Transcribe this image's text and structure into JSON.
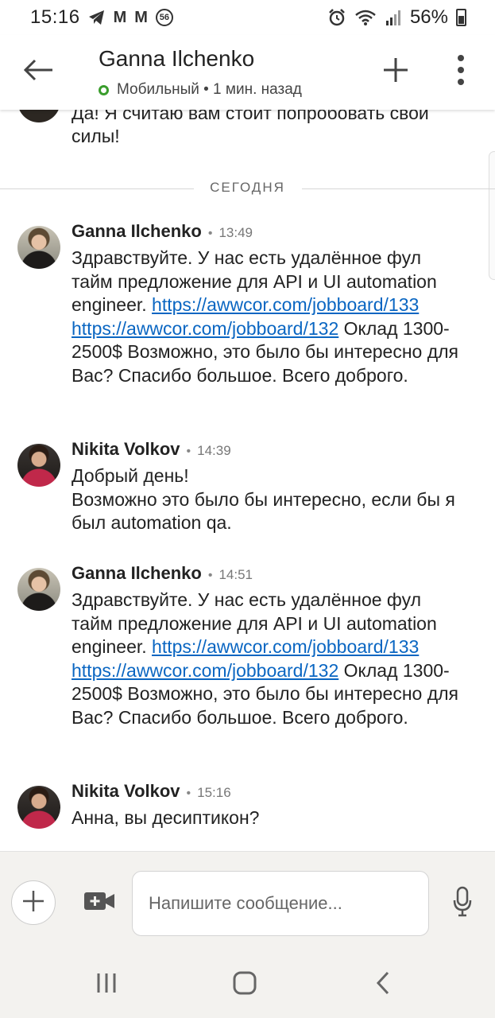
{
  "status_bar": {
    "time": "15:16",
    "notif_m1": "M",
    "notif_m2": "M",
    "notif_badge": "56",
    "battery": "56%"
  },
  "header": {
    "title": "Ganna Ilchenko",
    "presence": "Мобильный • 1 мин. назад",
    "presence_color": "#3a9d2c"
  },
  "previous_message": {
    "text": "Да! Я считаю вам стоит попробовать свои силы!"
  },
  "divider_label": "СЕГОДНЯ",
  "messages": [
    {
      "author": "Ganna Ilchenko",
      "separator": "•",
      "time": "13:49",
      "text_before": "Здравствуйте. У нас есть удалённое фул тайм предложение для API и UI automation engineer.",
      "link1": "https://awwcor.com/jobboard/133",
      "link2": "https://awwcor.com/jobboard/132",
      "text_after": "Оклад 1300-2500$ Возможно, это было бы интересно для Вас? Спасибо большое. Всего доброго."
    },
    {
      "author": "Nikita Volkov",
      "separator": "•",
      "time": "14:39",
      "line1": "Добрый день!",
      "line2": "Возможно это было бы интересно, если бы я был automation qa."
    },
    {
      "author": "Ganna Ilchenko",
      "separator": "•",
      "time": "14:51",
      "text_before": "Здравствуйте. У нас есть удалённое фул тайм предложение для API и UI automation engineer.",
      "link1": "https://awwcor.com/jobboard/133",
      "link2": "https://awwcor.com/jobboard/132",
      "text_after": "Оклад 1300-2500$ Возможно, это было бы интересно для Вас? Спасибо большое. Всего доброго."
    },
    {
      "author": "Nikita Volkov",
      "separator": "•",
      "time": "15:16",
      "line1": "Анна, вы десиптикон?"
    }
  ],
  "composer": {
    "placeholder": "Напишите сообщение..."
  },
  "colors": {
    "link": "#0a66c2",
    "background": "#ffffff",
    "composer_bg": "#f3f2ef"
  },
  "icons": {
    "back": "arrow-left-icon",
    "header_add": "plus-icon",
    "more": "more-vertical-icon",
    "composer_add": "plus-circle-icon",
    "video": "video-plus-icon",
    "mic": "microphone-icon"
  }
}
